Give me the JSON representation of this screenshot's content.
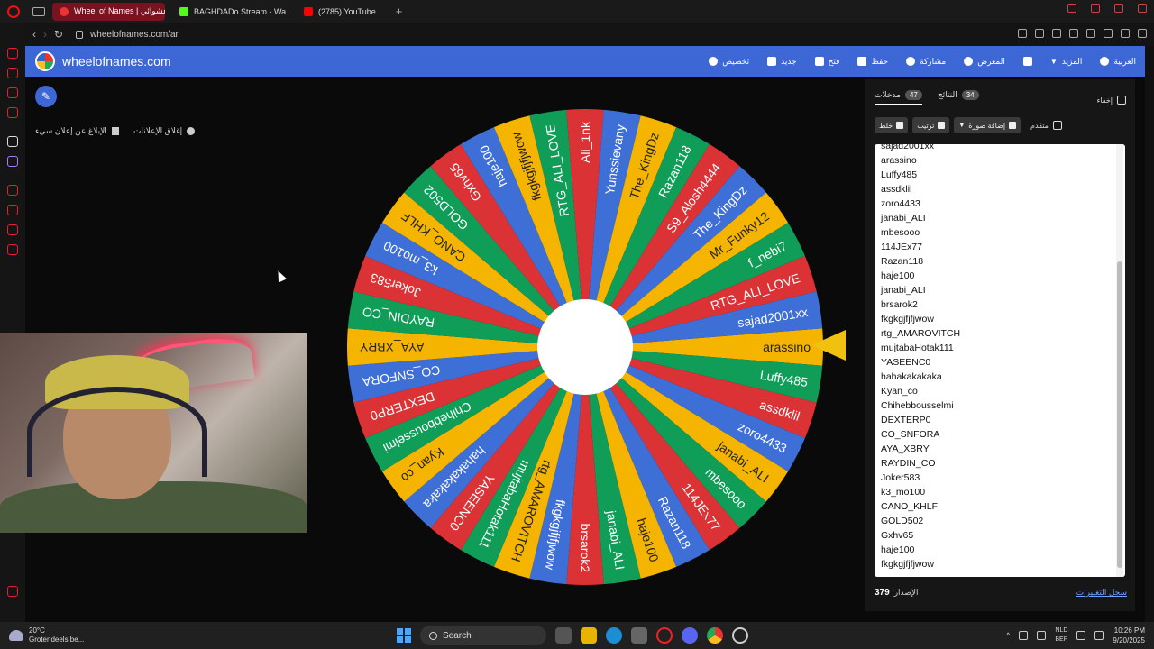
{
  "browser": {
    "tabs": [
      {
        "label": "Wheel of Names | عجلة عشوائي",
        "active": true,
        "color": "#e33"
      },
      {
        "label": "BAGHDADo Stream - Wa...",
        "active": false,
        "color": "#53fc18"
      },
      {
        "label": "(2785) YouTube",
        "active": false,
        "color": "#f00"
      }
    ],
    "url": "wheelofnames.com/ar"
  },
  "appbar": {
    "brand": "wheelofnames.com",
    "menu": [
      {
        "label": "تخصيص",
        "icon": "palette-icon"
      },
      {
        "label": "جديد",
        "icon": "new-file-icon"
      },
      {
        "label": "فتح",
        "icon": "folder-open-icon"
      },
      {
        "label": "حفظ",
        "icon": "save-icon"
      },
      {
        "label": "مشاركة",
        "icon": "share-icon"
      },
      {
        "label": "المعرض",
        "icon": "search-icon"
      },
      {
        "label": "",
        "icon": "fullscreen-icon"
      },
      {
        "label": "المزيد",
        "icon": "chevron-down-icon"
      },
      {
        "label": "العربية",
        "icon": "globe-icon"
      }
    ]
  },
  "ads": {
    "close_ads": "إغلاق الإعلانات",
    "report_ad": "الإبلاغ عن إعلان سيء"
  },
  "panel": {
    "tab_entries": {
      "label": "مدخلات",
      "count": "47"
    },
    "tab_results": {
      "label": "النتائج",
      "count": "34"
    },
    "hide": "إخفاء",
    "shuffle": "خلط",
    "sort": "ترتيب",
    "add_image": "إضافة صورة",
    "advanced": "متقدم",
    "entries": [
      "sajad2001xx",
      "arassino",
      "Luffy485",
      "assdklil",
      "zoro4433",
      "janabi_ALI",
      "mbesooo",
      "114JEx77",
      "Razan118",
      "haje100",
      "janabi_ALI",
      "brsarok2",
      "fkgkgjfjfjwow",
      "rtg_AMAROVITCH",
      "mujtabaHotak111",
      "YASEENC0",
      "hahakakakaka",
      "Kyan_co",
      "Chihebbousselmi",
      "DEXTERP0",
      "CO_SNFORA",
      "AYA_XBRY",
      "RAYDIN_CO",
      "Joker583",
      "k3_mo100",
      "CANO_KHLF",
      "GOLD502",
      "Gxhv65",
      "haje100",
      "fkgkgjfjfjwow"
    ],
    "version_label": "الإصدار",
    "version": "379",
    "changelog": "سجل التغييرات"
  },
  "wheel": {
    "segments": [
      "arassino",
      "Luffy485",
      "assdklil",
      "zoro4433",
      "janabi_ALI",
      "mbesooo",
      "114JEx77",
      "Razan118",
      "haje100",
      "janabi_ALI",
      "brsarok2",
      "fkgkgjfjfjwow",
      "rtg_AMAROVITCH",
      "mujtabaHotak111",
      "YASEENC0",
      "hahakakakaka",
      "Kyan_co",
      "Chihebbousselmi",
      "DEXTERP0",
      "CO_SNFORA",
      "AYA_XBRY",
      "RAYDIN_CO",
      "Joker583",
      "k3_mo100",
      "CANO_KHLF",
      "GOLD502",
      "Gxhv65",
      "haje100",
      "fkgkgjfjfjwow",
      "RTG_ALI_LOVE",
      "Ali_1nk",
      "Yunssievany",
      "The_KingDz",
      "Razan118",
      "S9_Alosh4444",
      "The_KingDz",
      "Mr_Funky12",
      "f_nebi7",
      "RTG_ALI_LOVE",
      "sajad2001xx"
    ],
    "colors": [
      "#f4b400",
      "#0f9d58",
      "#db3236",
      "#3e6fd6"
    ]
  },
  "taskbar": {
    "temp": "20°C",
    "weather": "Grotendeels be...",
    "search": "Search",
    "lang1": "NLD",
    "lang2": "BEP",
    "time": "10:26 PM",
    "date": "9/20/2025"
  }
}
